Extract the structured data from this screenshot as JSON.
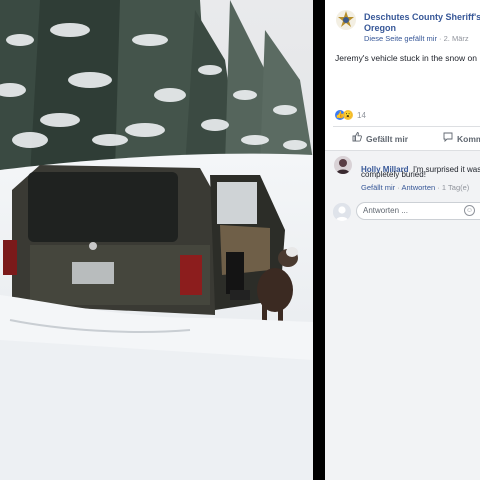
{
  "post": {
    "page_name_line1": "Deschutes County Sheriff's O",
    "page_name_line2": "Oregon",
    "liked_text": "Diese Seite gefällt mir",
    "date": "2. März",
    "text": "Jeremy's vehicle stuck in the snow on I",
    "reaction_count": "14",
    "like_label": "Gefällt mir",
    "comment_label": "Komm"
  },
  "comment": {
    "author": "Holly Millard",
    "text_line1": "I'm surprised it wasn",
    "text_line2": "completely buried!",
    "like_label": "Gefällt mir",
    "reply_label": "Antworten",
    "time": "1 Tag(e)"
  },
  "reply": {
    "placeholder": "Antworten ..."
  },
  "colors": {
    "link": "#385898",
    "text": "#1d2129",
    "muted": "#90949c"
  },
  "icons": {
    "page_avatar": "sheriff-star-icon",
    "like": "thumbs-up-icon",
    "comment": "speech-bubble-icon",
    "emoji": "smiley-icon"
  }
}
